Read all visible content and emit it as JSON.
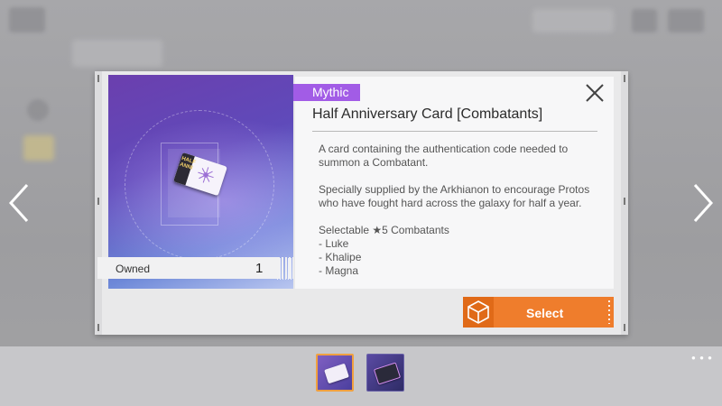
{
  "item": {
    "rarity": "Mythic",
    "title": "Half Anniversary Card [Combatants]",
    "owned_label": "Owned",
    "owned_value": "1",
    "description": [
      "A card containing the authentication code needed to summon a Combatant.",
      "Specially supplied by the Arkhianon to encourage Protos who have fought hard across the galaxy for half a year.",
      "Selectable ★5 Combatants",
      " - Luke",
      " - Khalipe",
      " - Magna"
    ]
  },
  "actions": {
    "select_label": "Select"
  },
  "colors": {
    "rarity": "#a25ce6",
    "select": "#ef7d2c",
    "thumb_selected_border": "#f0a040"
  },
  "icons": {
    "close": "close-icon",
    "prev": "chevron-left-icon",
    "next": "chevron-right-icon",
    "select": "cube-icon"
  },
  "thumbnails": [
    {
      "name": "half-anniversary-card-thumb",
      "selected": true
    },
    {
      "name": "alt-card-thumb",
      "selected": false
    }
  ]
}
